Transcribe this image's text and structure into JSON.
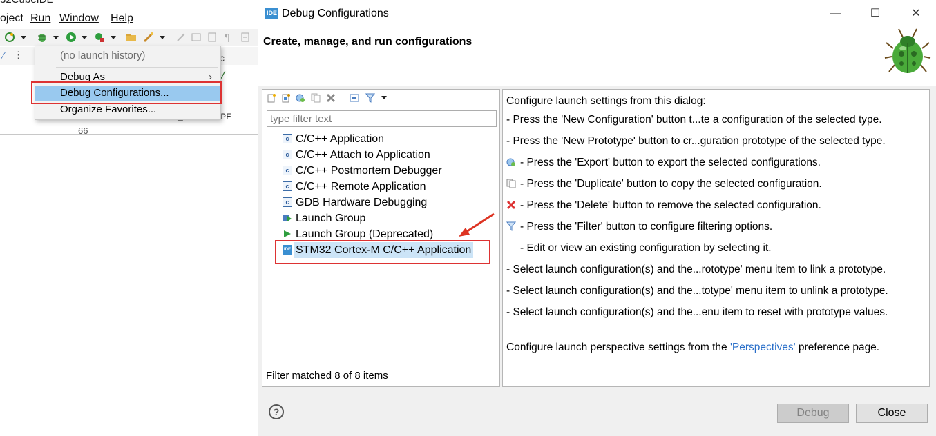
{
  "ide": {
    "title_fragment": "32CubeIDE",
    "menus": [
      {
        "label": "oject"
      },
      {
        "label": "Run"
      },
      {
        "label": "Window"
      },
      {
        "label": "Help"
      }
    ],
    "code_fragment": "#define FSTCHAR_PROTOTYPE",
    "code_comment": "*/",
    "line_number": "66",
    "dropdown": {
      "no_history": "(no launch history)",
      "debug_as": "Debug As",
      "debug_configurations": "Debug Configurations...",
      "organize_favorites": "Organize Favorites..."
    }
  },
  "dialog": {
    "window_title": "Debug Configurations",
    "logo_text": "IDE",
    "header_title": "Create, manage, and run configurations",
    "filter_placeholder": "type filter text",
    "tree_items": [
      "C/C++ Application",
      "C/C++ Attach to Application",
      "C/C++ Postmortem Debugger",
      "C/C++ Remote Application",
      "GDB Hardware Debugging",
      "Launch Group",
      "Launch Group (Deprecated)",
      "STM32 Cortex-M C/C++ Application"
    ],
    "filter_status": "Filter matched 8 of 8 items",
    "help_lines": [
      "Configure launch settings from this dialog:",
      "- Press the 'New Configuration' button t...te a configuration of the selected type.",
      "- Press the 'New Prototype' button to cr...guration prototype of the selected type.",
      "- Press the 'Export' button to export the selected configurations.",
      "- Press the 'Duplicate' button to copy the selected configuration.",
      "- Press the 'Delete' button to remove the selected configuration.",
      "- Press the 'Filter' button to configure filtering options.",
      "- Edit or view an existing configuration by selecting it.",
      "- Select launch configuration(s) and the...rototype' menu item to link a prototype.",
      "- Select launch configuration(s) and the...totype' menu item to unlink a prototype.",
      "- Select launch configuration(s) and the...enu item to reset with prototype values."
    ],
    "perspective_line_pre": "Configure launch perspective settings from the ",
    "perspective_link": "'Perspectives'",
    "perspective_line_post": " preference page.",
    "buttons": {
      "debug": "Debug",
      "close": "Close"
    }
  },
  "colors": {
    "selection": "#99c9ef",
    "highlight_red": "#dd3333",
    "link": "#2a6fc9"
  }
}
